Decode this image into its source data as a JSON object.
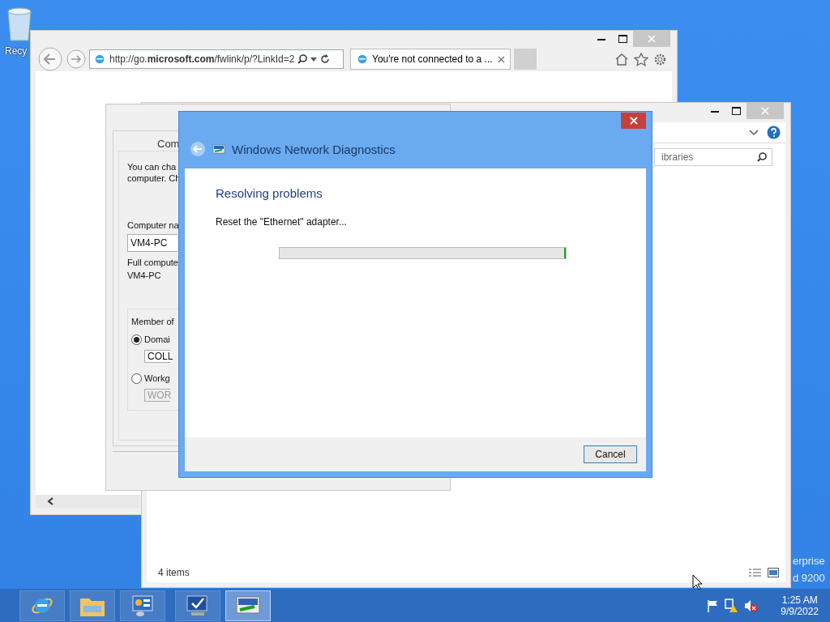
{
  "desktop": {
    "recycle_bin_label": "Recy",
    "edition_lines": [
      "erprise",
      "d 9200"
    ]
  },
  "browser": {
    "address": "http://go.**microsoft.com**/fwlink/p/?LinkId=2",
    "tab": {
      "title": "You're not connected to a ...",
      "selected": true
    }
  },
  "explorer": {
    "search_placeholder": "ibraries",
    "status": "4 items"
  },
  "system_properties": {
    "tab_label": "Com",
    "intro_lines": [
      "You can cha",
      "computer. Ch"
    ],
    "computer_name_label": "Computer na",
    "computer_name": "VM4-PC",
    "full_name_label": "Full compute",
    "full_name": "VM4-PC",
    "member_of_label": "Member of",
    "options": [
      {
        "label": "Domai",
        "selected": true,
        "value": "COLL",
        "disabled": false
      },
      {
        "label": "Workg",
        "selected": false,
        "value": "WOR",
        "disabled": true
      }
    ]
  },
  "diagnostics": {
    "title": "Windows Network Diagnostics",
    "heading": "Resolving problems",
    "status": "Reset the \"Ethernet\" adapter...",
    "cancel": "Cancel",
    "progress": {
      "level": 1
    }
  },
  "taskbar": {
    "apps": [
      {
        "kind": "browser",
        "selected": false
      },
      {
        "kind": "folder",
        "selected": false
      },
      {
        "kind": "control-panel",
        "selected": false
      },
      {
        "kind": "monitor",
        "selected": false
      },
      {
        "kind": "network",
        "selected": true
      }
    ],
    "clock": {
      "time": "1:25 AM",
      "date": "9/9/2022"
    }
  }
}
